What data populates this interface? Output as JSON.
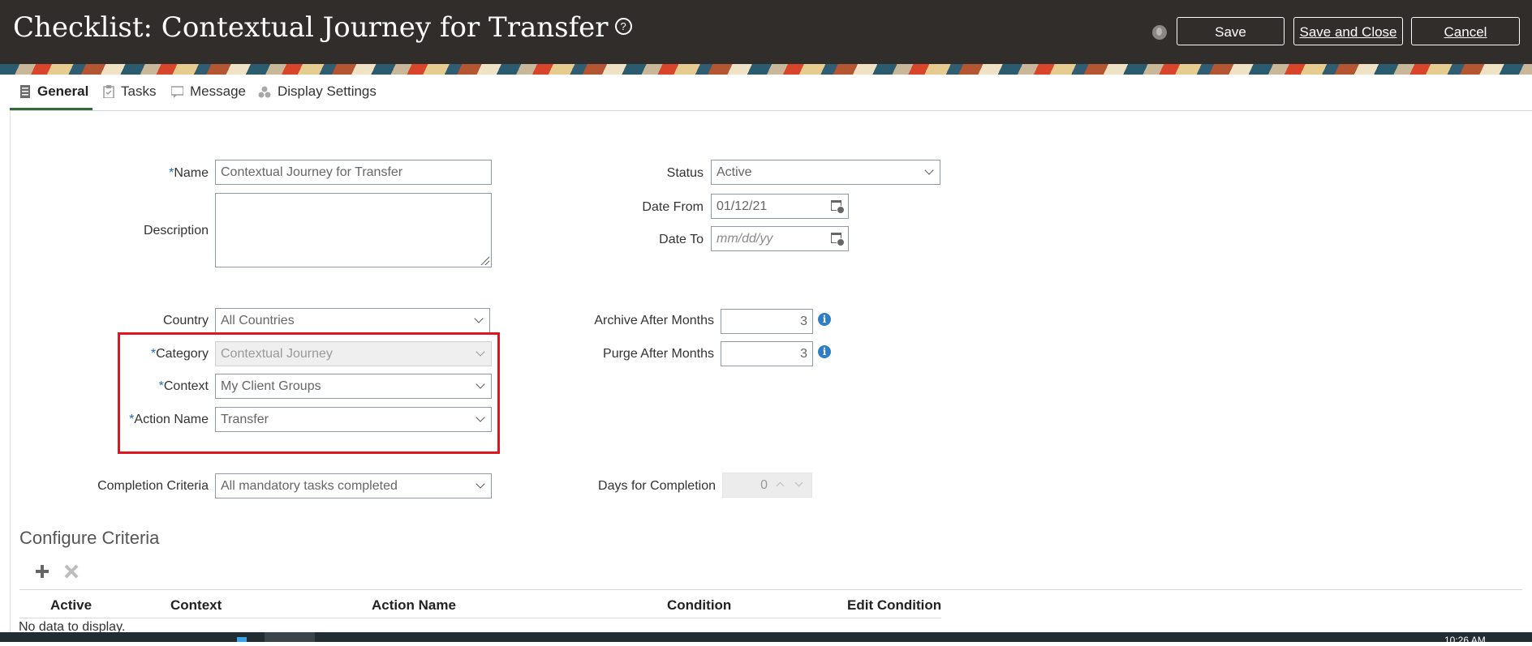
{
  "header": {
    "title": "Checklist: Contextual Journey for Transfer",
    "help_glyph": "?",
    "buttons": {
      "save": "Save",
      "save_close": "Save and Close",
      "cancel": "Cancel"
    }
  },
  "tabs": [
    {
      "label": "General",
      "icon": "general-doc-icon",
      "active": true
    },
    {
      "label": "Tasks",
      "icon": "tasks-clipboard-icon",
      "active": false
    },
    {
      "label": "Message",
      "icon": "message-icon",
      "active": false
    },
    {
      "label": "Display Settings",
      "icon": "display-settings-icon",
      "active": false
    }
  ],
  "form": {
    "required_mark": "*",
    "name": {
      "label": "Name",
      "value": "Contextual Journey for Transfer"
    },
    "description": {
      "label": "Description",
      "value": ""
    },
    "country": {
      "label": "Country",
      "value": "All Countries"
    },
    "category": {
      "label": "Category",
      "value": "Contextual Journey"
    },
    "context": {
      "label": "Context",
      "value": "My Client Groups"
    },
    "action_name": {
      "label": "Action Name",
      "value": "Transfer"
    },
    "completion_criteria": {
      "label": "Completion Criteria",
      "value": "All mandatory tasks completed"
    },
    "status": {
      "label": "Status",
      "value": "Active"
    },
    "date_from": {
      "label": "Date From",
      "value": "01/12/21"
    },
    "date_to": {
      "label": "Date To",
      "placeholder": "mm/dd/yy"
    },
    "archive_after_months": {
      "label": "Archive After Months",
      "value": "3"
    },
    "purge_after_months": {
      "label": "Purge After Months",
      "value": "3"
    },
    "days_for_completion": {
      "label": "Days for Completion",
      "value": "0"
    },
    "info_glyph": "i"
  },
  "criteria": {
    "title": "Configure Criteria",
    "columns": [
      "Active",
      "Context",
      "Action Name",
      "Condition",
      "Edit Condition"
    ],
    "empty_text": "No data to display."
  },
  "taskbar": {
    "clock": "10:26 AM"
  },
  "colors": {
    "header_bg": "#312d2a",
    "tab_active_underline": "#316b3a",
    "required_asterisk": "#1d65b7",
    "highlight_box": "#e0161f",
    "info_icon": "#2f7ec4"
  }
}
